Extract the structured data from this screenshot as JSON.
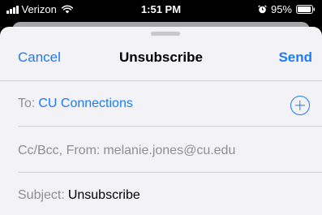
{
  "status_bar": {
    "carrier": "Verizon",
    "time": "1:51 PM",
    "battery": "95%",
    "battery_level": 0.95,
    "icons": [
      "signal-icon",
      "wifi-icon",
      "alarm-icon",
      "battery-icon"
    ]
  },
  "compose": {
    "cancel_label": "Cancel",
    "title": "Unsubscribe",
    "send_label": "Send",
    "to_label": "To:",
    "to_value": "CU Connections",
    "add_contact_icon": "plus-circle-icon",
    "cc_label": "Cc/Bcc, From:",
    "cc_value": "melanie.jones@cu.edu",
    "subject_label": "Subject:",
    "subject_value": "Unsubscribe"
  },
  "colors": {
    "accent": "#1a7cf5",
    "sheet_background": "#f2f2f7",
    "label_gray": "#8e8e93",
    "separator": "#d1d1d6"
  }
}
